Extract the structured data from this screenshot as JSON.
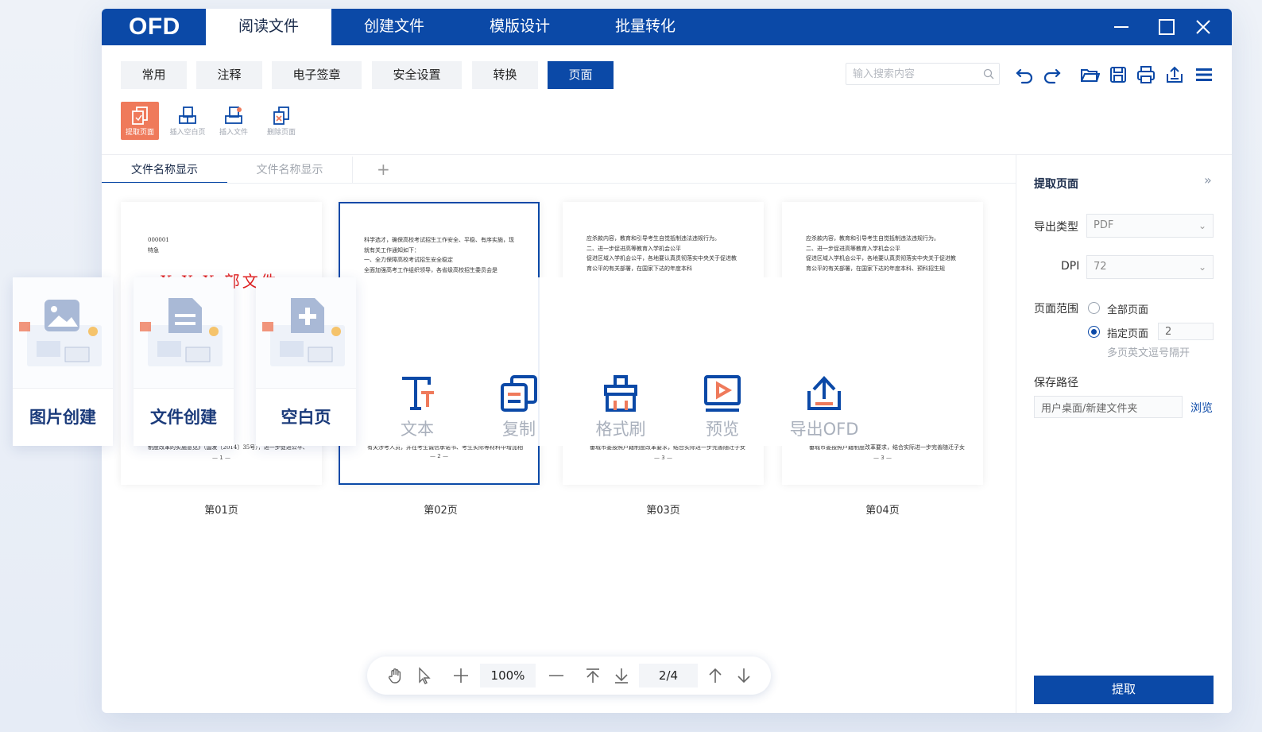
{
  "titlebar": {
    "logo": "OFD",
    "tabs": [
      "阅读文件",
      "创建文件",
      "模版设计",
      "批量转化"
    ],
    "active_tab": 0
  },
  "ribbon": {
    "tabs": [
      "常用",
      "注释",
      "电子签章",
      "安全设置",
      "转换",
      "页面"
    ],
    "active_tab": 5,
    "search_placeholder": "输入搜索内容",
    "subtools": [
      {
        "label": "提取页面",
        "icon": "extract-page-icon"
      },
      {
        "label": "插入空白页",
        "icon": "insert-blank-page-icon"
      },
      {
        "label": "插入文件",
        "icon": "insert-file-icon"
      },
      {
        "label": "删除页面",
        "icon": "delete-page-icon"
      }
    ]
  },
  "doc_tabs": [
    "文件名称显示",
    "文件名称显示"
  ],
  "add_tab": "+",
  "pages": [
    {
      "label": "第01页",
      "header_code": "000001",
      "header_note": "特急",
      "title": "X X X 部文件",
      "body": "",
      "tail": "制度改革的实施意见》（国发〔2014〕35号），进一步促进公平、",
      "footer": "— 1 —"
    },
    {
      "label": "第02页",
      "body": "科学选才，确保高校考试招生工作安全、平稳、有序实施，现就有关工作通知如下：\n一、全力保障高校考试招生安全稳定\n全面加强高考工作组织领导，各省级高校招生委员会是",
      "tail": "有关涉考人员，并在考生诚信承诺书、考生实际等材料中增加相",
      "footer": "— 2 —"
    },
    {
      "label": "第03页",
      "body": "应杀款内容，教育和引导考生自觉抵制违法违规行为。\n二、进一步促进高等教育入学机会公平\n促进区域入学机会公平，各地要认真贯彻落实中央关于促进教育公平的有关部署，在国家下达的年度本科",
      "tail": "垂城市委按照户籍制度改革要求，结合实际进一步完善随迁子女",
      "footer": "— 3 —"
    },
    {
      "label": "第04页",
      "body": "应杀款内容，教育和引导考生自觉抵制违法违规行为。\n二、进一步促进高等教育入学机会公平\n促进区域入学机会公平，各地要认真贯彻落实中央关于促进教育公平的有关部署，在国家下达的年度本科、预科招生规",
      "tail": "垂城市委按照户籍制度改革要求，结合实际进一步完善随迁子女",
      "footer": "— 3 —"
    }
  ],
  "right_panel": {
    "title": "提取页面",
    "collapse": "»",
    "export_type_label": "导出类型",
    "export_type_value": "PDF",
    "dpi_label": "DPI",
    "dpi_value": "72",
    "range_label": "页面范围",
    "range_all": "全部页面",
    "range_specified": "指定页面",
    "range_selected": "specified",
    "range_value": "2",
    "range_hint": "多页英文逗号隔开",
    "save_label": "保存路径",
    "save_path": "用户桌面/新建文件夹",
    "browse": "浏览",
    "submit": "提取"
  },
  "bottom_bar": {
    "zoom": "100%",
    "page_indicator": "2/4"
  },
  "overlay": {
    "cards": [
      "图片创建",
      "文件创建",
      "空白页"
    ],
    "buttons": [
      {
        "label": "文本",
        "icon": "text-icon"
      },
      {
        "label": "复制",
        "icon": "copy-icon"
      },
      {
        "label": "格式刷",
        "icon": "format-brush-icon"
      },
      {
        "label": "预览",
        "icon": "preview-icon"
      },
      {
        "label": "导出OFD",
        "icon": "export-ofd-icon"
      }
    ]
  },
  "colors": {
    "brand": "#0b49a7",
    "accent": "#ef7a5b",
    "red_title": "#e02020"
  }
}
